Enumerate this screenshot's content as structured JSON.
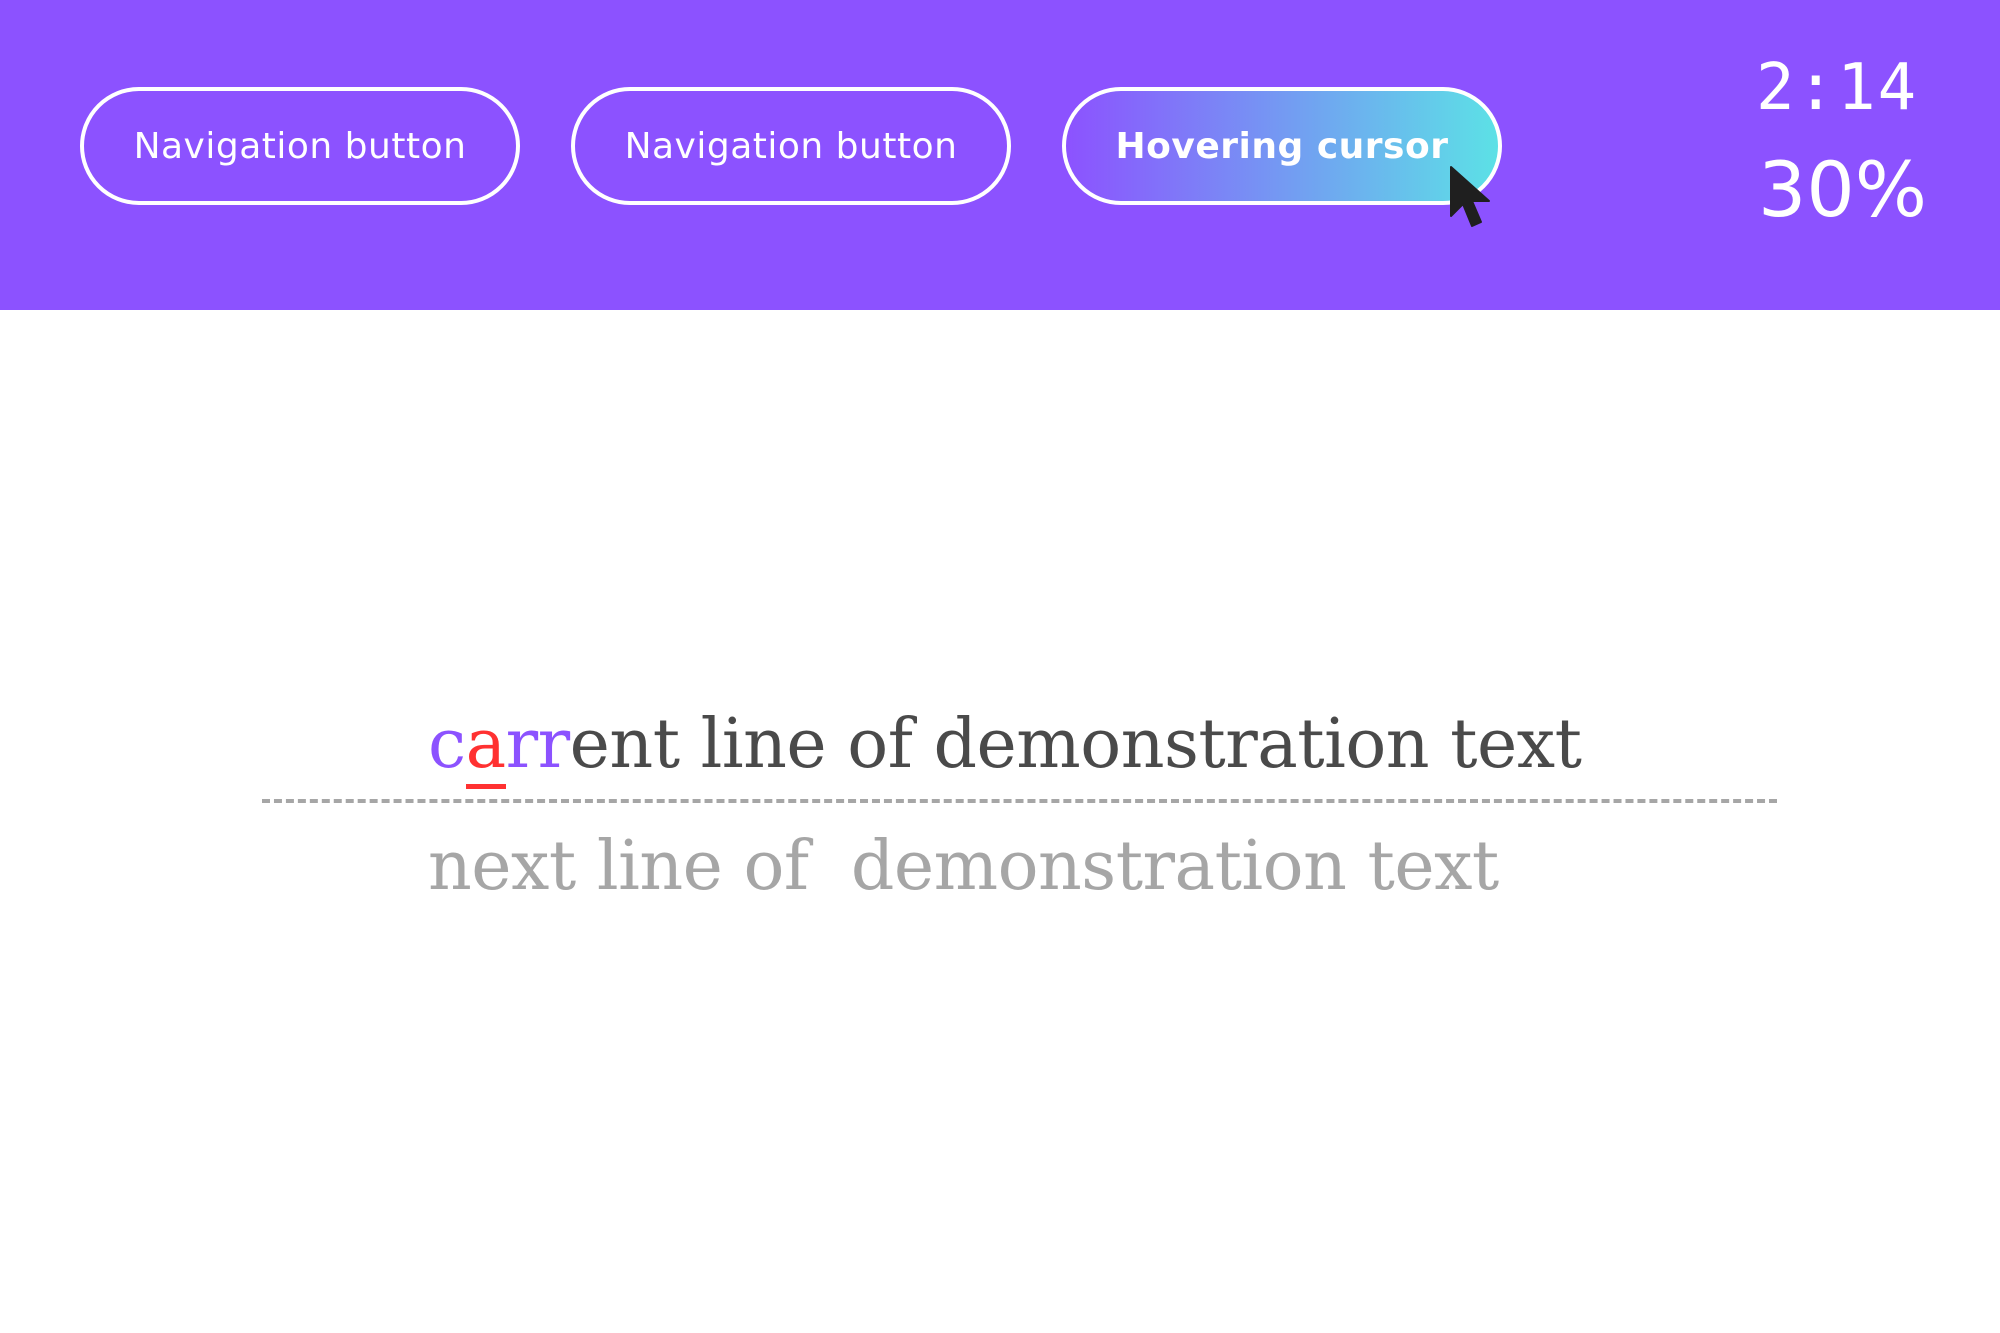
{
  "header": {
    "background_color": "#8c52ff",
    "nav_buttons": [
      {
        "label": "Navigation button"
      },
      {
        "label": "Navigation button"
      },
      {
        "label": "Hovering cursor",
        "state": "hover",
        "gradient": [
          "#8c52ff",
          "#5ce1e6"
        ]
      }
    ],
    "timer": "2:14",
    "progress": "30%"
  },
  "typing": {
    "current_line": {
      "typed_correct_1": "c",
      "typed_error": "a",
      "typed_correct_2": "rr",
      "remaining": "ent line of demonstration text"
    },
    "next_line": "next line of  demonstration text",
    "colors": {
      "typed": "#8c52ff",
      "error": "#ff3131",
      "pending": "#4a4a4a",
      "upcoming": "#a6a6a6"
    }
  },
  "icons": {
    "cursor": "mouse-pointer-icon"
  }
}
